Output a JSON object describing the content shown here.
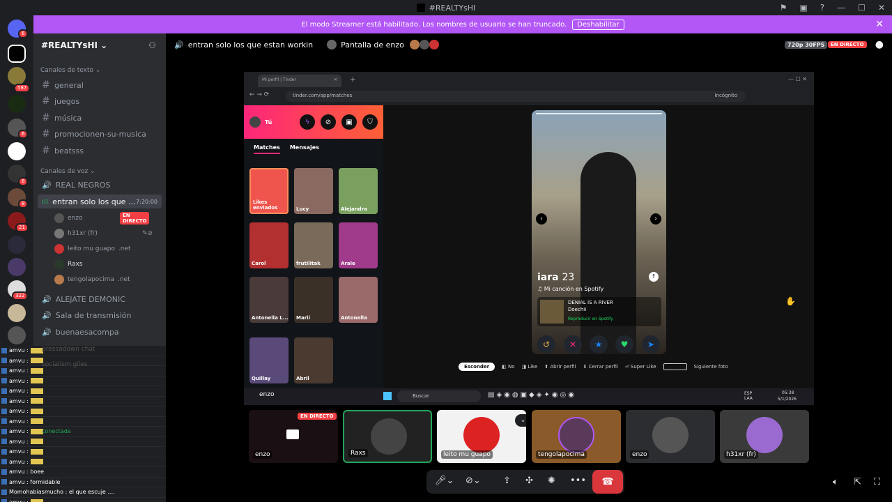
{
  "window": {
    "title": "#REALTYsHI"
  },
  "streamer": {
    "message": "El modo Streamer está habilitado. Los nombres de usuario se han truncado.",
    "button": "Deshabilitar"
  },
  "guild_badges": [
    "6",
    "587",
    "6",
    "8",
    "8",
    "6",
    "21",
    "322"
  ],
  "server": {
    "name": "#REALTYsHI"
  },
  "text_category": "Canales de texto",
  "text_channels": [
    "general",
    "juegos",
    "música",
    "promocionen-su-musica",
    "beatsss"
  ],
  "voice_category": "Canales de voz",
  "voice_channels": {
    "real_negros": "REAL NEGROS",
    "active": "entran solo los que ...",
    "active_time": "7:20:00",
    "alejate": "ALEJATE DEMONIC",
    "sala": "Sala de transmisión",
    "buenaesa": "buenaesacompa",
    "pressadown": "pressadown chat",
    "socialism": "socialism giles"
  },
  "voice_users": [
    {
      "name": "enzo",
      "badge": "EN DIRECTO"
    },
    {
      "name": "h31xr (fr)",
      "badge": ""
    },
    {
      "name": "leito mu guapo",
      "badge": ".net"
    },
    {
      "name": "Raxs",
      "badge": ""
    },
    {
      "name": "tengolapocima",
      "badge": ".net"
    }
  ],
  "chat_lines": [
    "amvu :",
    "amvu :",
    "amvu :",
    "amvu :",
    "amvu :",
    "amvu :",
    "amvu :",
    "amvu :",
    "amvu :",
    "amvu :",
    "amvu :",
    "amvu :",
    "amvu : boee",
    "amvu : formidable",
    "Momohabiasmucho : el que escuje ....",
    "amvu :",
    "amvu :"
  ],
  "chat_extra": {
    "conectada": "conectada"
  },
  "topbar": {
    "channel": "entran solo los que estan workin",
    "screen_of": "Pantalla de enzo",
    "quality": "720p 30FPS",
    "live": "EN DIRECTO"
  },
  "browser": {
    "tab": "Mi perfil | Tinder",
    "url": "tinder.com/app/matches",
    "incognito": "Incógnito"
  },
  "tinder": {
    "me": "Tú",
    "tab_matches": "Matches",
    "tab_messages": "Mensajes",
    "likes_label": "Likes enviados",
    "thumbs": [
      "Lucy",
      "Alejandra",
      "Carol",
      "frutilitak",
      "Arale",
      "Antonella L...",
      "Marii",
      "Antonella",
      "Quillay",
      "Abril"
    ]
  },
  "profile": {
    "name": "iara",
    "age": "23",
    "spotify": "Mi canción en Spotify",
    "song": "DENIAL IS A RIVER",
    "artist": "Doechii",
    "play": "Reproducir en Spotify"
  },
  "hints": {
    "esconder": "Esconder",
    "no": "No",
    "like": "Like",
    "abrir": "Abrir perfil",
    "cerrar": "Cerrar perfil",
    "super": "Super Like",
    "siguiente": "Siguiente foto"
  },
  "taskbar": {
    "search": "Buscar",
    "lang": "ESP\nLAA",
    "time": "05:38",
    "date": "5/1/2026",
    "user": "enzo"
  },
  "tiles": [
    {
      "name": "enzo",
      "live": "EN DIRECTO"
    },
    {
      "name": "Raxs"
    },
    {
      "name": "leito mu guapo"
    },
    {
      "name": "tengolapocima"
    },
    {
      "name": "enzo"
    },
    {
      "name": "h31xr (fr)"
    }
  ],
  "colors": {
    "accent": "#b256f5",
    "live": "#f23f43",
    "end_call": "#da373c"
  }
}
